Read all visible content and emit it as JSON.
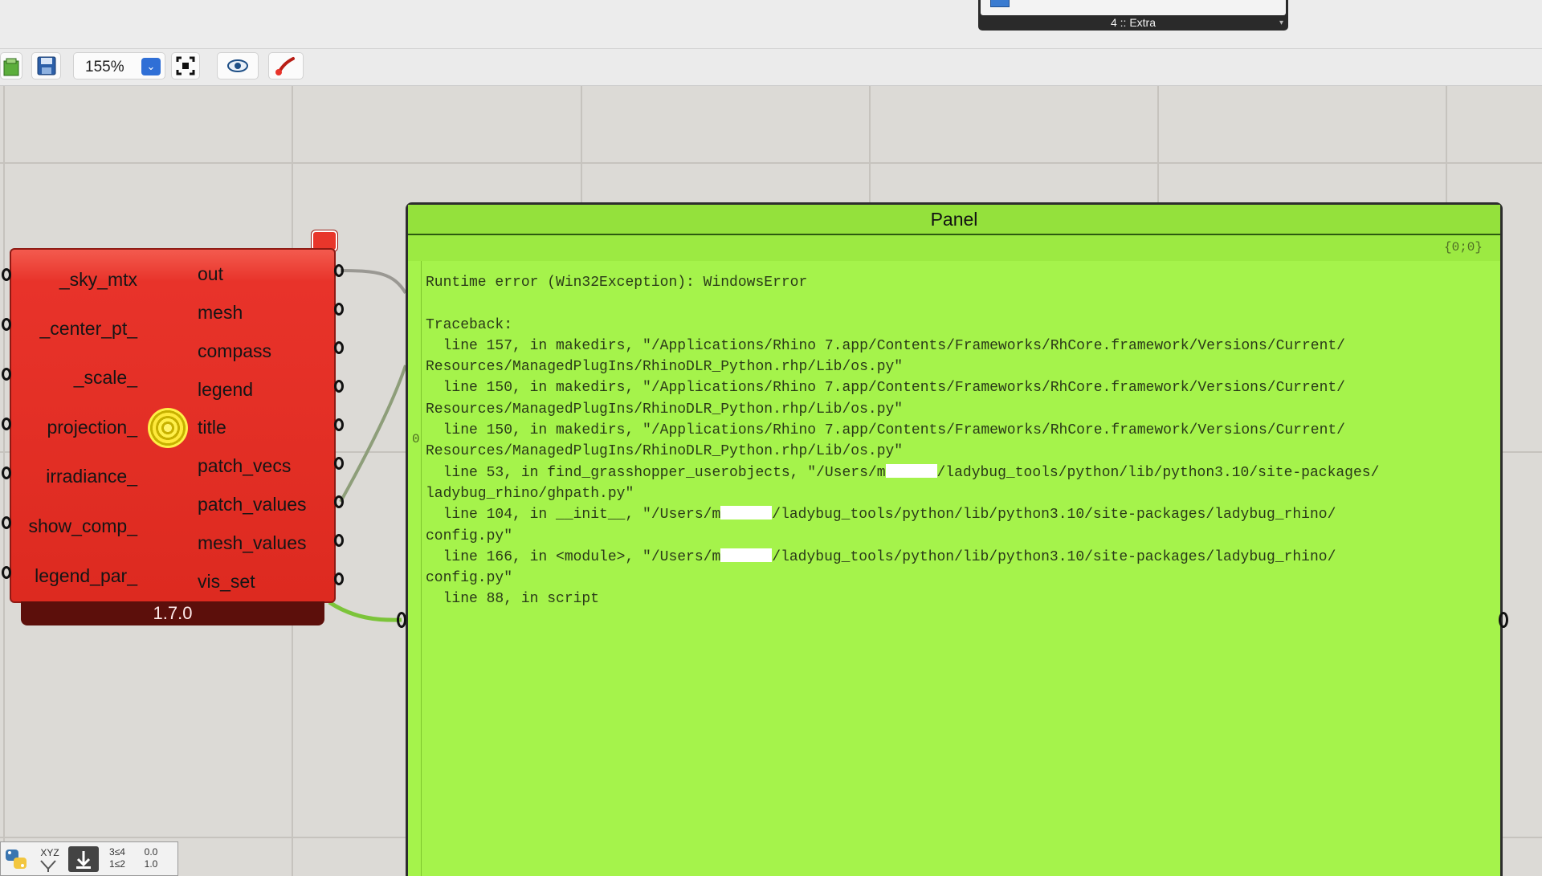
{
  "ribbon": {
    "tab_label": "4 :: Extra"
  },
  "toolbar": {
    "zoom": "155%",
    "icons": [
      "open-icon",
      "save-icon",
      "zoom-dropdown-icon",
      "zoom-extents-icon",
      "preview-eye-icon",
      "sketch-brush-icon"
    ]
  },
  "component": {
    "inputs": [
      "_sky_mtx",
      "_center_pt_",
      "_scale_",
      "projection_",
      "irradiance_",
      "show_comp_",
      "legend_par_"
    ],
    "outputs": [
      "out",
      "mesh",
      "compass",
      "legend",
      "title",
      "patch_vecs",
      "patch_values",
      "mesh_values",
      "vis_set"
    ],
    "version": "1.7.0",
    "colors": {
      "body": "#e8332a",
      "footer": "#5c0f0b"
    }
  },
  "panel": {
    "title": "Panel",
    "path": "{0;0}",
    "index": "0",
    "color": "#a5f34b",
    "lines": {
      "l0": "Runtime error (Win32Exception): WindowsError",
      "l1": "",
      "l2": "Traceback:",
      "l3": "  line 157, in makedirs, \"/Applications/Rhino 7.app/Contents/Frameworks/RhCore.framework/Versions/Current/",
      "l4": "Resources/ManagedPlugIns/RhinoDLR_Python.rhp/Lib/os.py\"",
      "l5": "  line 150, in makedirs, \"/Applications/Rhino 7.app/Contents/Frameworks/RhCore.framework/Versions/Current/",
      "l6": "Resources/ManagedPlugIns/RhinoDLR_Python.rhp/Lib/os.py\"",
      "l7": "  line 150, in makedirs, \"/Applications/Rhino 7.app/Contents/Frameworks/RhCore.framework/Versions/Current/",
      "l8": "Resources/ManagedPlugIns/RhinoDLR_Python.rhp/Lib/os.py\"",
      "l9a": "  line 53, in find_grasshopper_userobjects, \"/Users/m",
      "l9b": "/ladybug_tools/python/lib/python3.10/site-packages/",
      "l10": "ladybug_rhino/ghpath.py\"",
      "l11a": "  line 104, in __init__, \"/Users/m",
      "l11b": "/ladybug_tools/python/lib/python3.10/site-packages/ladybug_rhino/",
      "l12": "config.py\"",
      "l13a": "  line 166, in <module>, \"/Users/m",
      "l13b": "/ladybug_tools/python/lib/python3.10/site-packages/ladybug_rhino/",
      "l14": "config.py\"",
      "l15": "  line 88, in script"
    }
  },
  "bottom_bar": {
    "items": [
      "python-icon",
      "xyz-icon",
      "download-icon",
      "sort-icon",
      "number-slider-icon"
    ],
    "xyz_label": "XYZ",
    "sort_label": "3≤4\n1≤2",
    "slider_label": "0.0\n1.0"
  }
}
